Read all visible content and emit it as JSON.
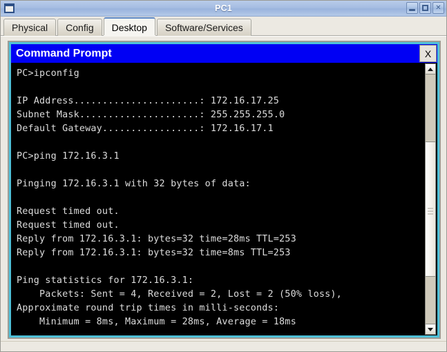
{
  "window": {
    "title": "PC1",
    "menu_icon": "window-icon",
    "buttons": {
      "minimize": "minimize-icon",
      "maximize": "maximize-icon",
      "close": "✕"
    }
  },
  "tabs": [
    {
      "label": "Physical",
      "selected": false
    },
    {
      "label": "Config",
      "selected": false
    },
    {
      "label": "Desktop",
      "selected": true
    },
    {
      "label": "Software/Services",
      "selected": false
    }
  ],
  "command_prompt": {
    "title": "Command Prompt",
    "close_label": "X",
    "colors": {
      "title_bar": "#0000f4",
      "frame": "#4ec0d8",
      "background": "#000000",
      "text": "#dcdcdc"
    },
    "terminal_lines": [
      "PC>ipconfig",
      "",
      "IP Address......................: 172.16.17.25",
      "Subnet Mask.....................: 255.255.255.0",
      "Default Gateway.................: 172.16.17.1",
      "",
      "PC>ping 172.16.3.1",
      "",
      "Pinging 172.16.3.1 with 32 bytes of data:",
      "",
      "Request timed out.",
      "Request timed out.",
      "Reply from 172.16.3.1: bytes=32 time=28ms TTL=253",
      "Reply from 172.16.3.1: bytes=32 time=8ms TTL=253",
      "",
      "Ping statistics for 172.16.3.1:",
      "    Packets: Sent = 4, Received = 2, Lost = 2 (50% loss),",
      "Approximate round trip times in milli-seconds:",
      "    Minimum = 8ms, Maximum = 28ms, Average = 18ms"
    ],
    "ipconfig": {
      "command": "PC>ipconfig",
      "ip_address_label": "IP Address",
      "ip_address": "172.16.17.25",
      "subnet_mask_label": "Subnet Mask",
      "subnet_mask": "255.255.255.0",
      "default_gateway_label": "Default Gateway",
      "default_gateway": "172.16.17.1"
    },
    "ping": {
      "command": "PC>ping 172.16.3.1",
      "target": "172.16.3.1",
      "bytes": "32",
      "header": "Pinging 172.16.3.1 with 32 bytes of data:",
      "replies": [
        "Request timed out.",
        "Request timed out.",
        "Reply from 172.16.3.1: bytes=32 time=28ms TTL=253",
        "Reply from 172.16.3.1: bytes=32 time=8ms TTL=253"
      ],
      "statistics_header": "Ping statistics for 172.16.3.1:",
      "packets_sent": "4",
      "packets_received": "2",
      "packets_lost": "2",
      "loss_percent": "50%",
      "rtt_header": "Approximate round trip times in milli-seconds:",
      "rtt_minimum": "8ms",
      "rtt_maximum": "28ms",
      "rtt_average": "18ms"
    },
    "scrollbar": {
      "up_arrow": "scroll-up-icon",
      "down_arrow": "scroll-down-icon"
    }
  }
}
